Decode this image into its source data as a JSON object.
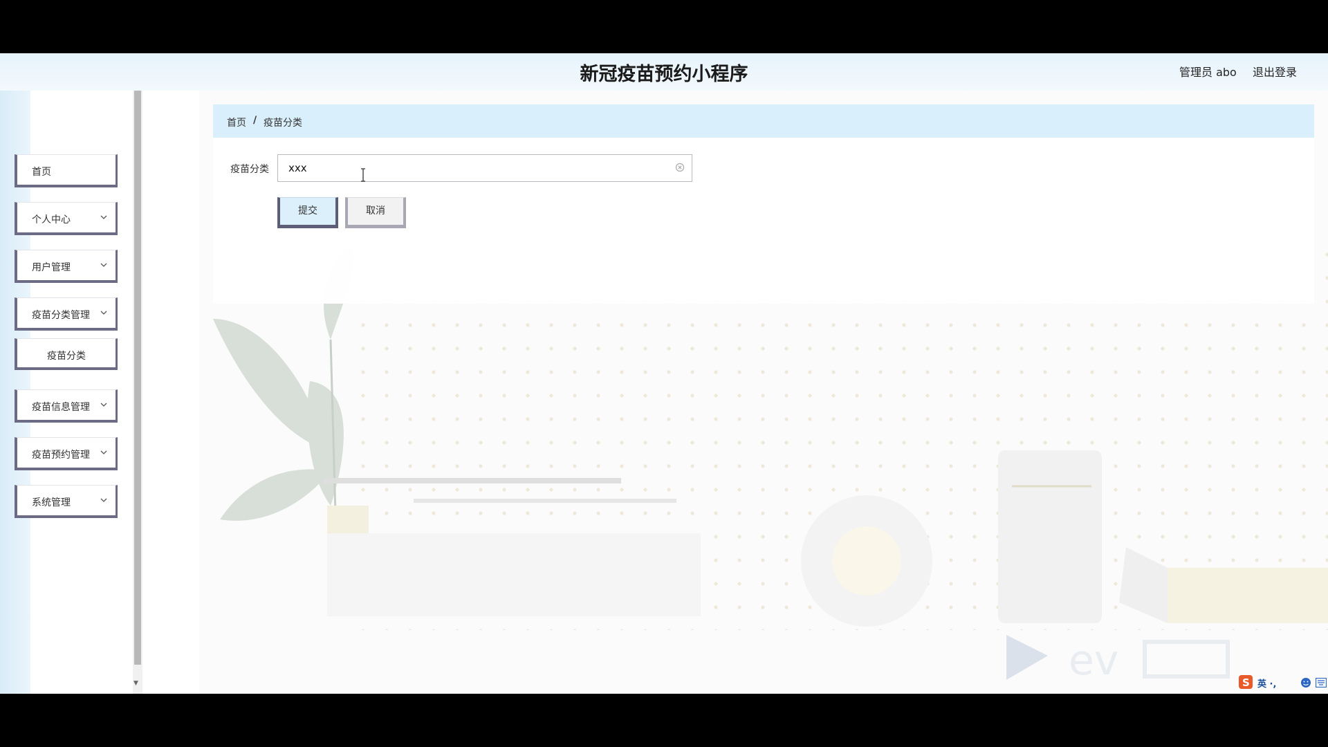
{
  "header": {
    "app_title": "新冠疫苗预约小程序",
    "user_label": "管理员 abo",
    "logout_label": "退出登录"
  },
  "sidebar": {
    "items": [
      {
        "label": "首页",
        "has_submenu": false
      },
      {
        "label": "个人中心",
        "has_submenu": true
      },
      {
        "label": "用户管理",
        "has_submenu": true
      },
      {
        "label": "疫苗分类管理",
        "has_submenu": true,
        "expanded": true
      },
      {
        "label": "疫苗分类",
        "is_subitem": true
      },
      {
        "label": "疫苗信息管理",
        "has_submenu": true
      },
      {
        "label": "疫苗预约管理",
        "has_submenu": true
      },
      {
        "label": "系统管理",
        "has_submenu": true
      }
    ]
  },
  "breadcrumb": {
    "home": "首页",
    "separator": "/",
    "current": "疫苗分类"
  },
  "form": {
    "field_label": "疫苗分类",
    "field_value": "xxx",
    "submit_label": "提交",
    "cancel_label": "取消"
  },
  "tray": {
    "ime_label": "英 ·,",
    "icons": [
      "sogou-ime-icon",
      "emoji-icon",
      "keyboard-icon"
    ]
  },
  "colors": {
    "header_bg": "#e6f3fb",
    "breadcrumb_bg": "#d9effb",
    "menu_border": "#6b6b86",
    "submit_bg": "#dcf0fb"
  }
}
